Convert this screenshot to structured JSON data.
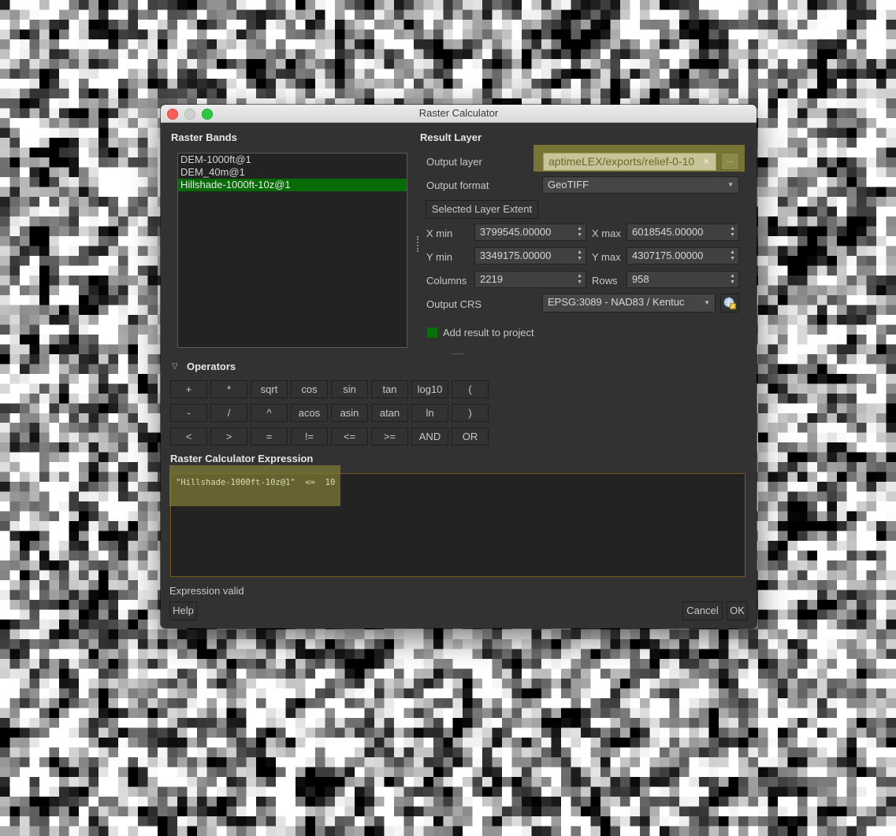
{
  "window": {
    "title": "Raster Calculator"
  },
  "raster_bands": {
    "heading": "Raster Bands",
    "items": [
      {
        "label": "DEM-1000ft@1",
        "selected": false
      },
      {
        "label": "DEM_40m@1",
        "selected": false
      },
      {
        "label": "Hillshade-1000ft-10z@1",
        "selected": true
      }
    ]
  },
  "result_layer": {
    "heading": "Result Layer",
    "output_layer_label": "Output layer",
    "output_layer_value": "aptimeLEX/exports/relief-0-10",
    "clear_icon": "×",
    "browse_label": "...",
    "output_format_label": "Output format",
    "output_format_value": "GeoTIFF",
    "selected_extent_button": "Selected Layer Extent",
    "xmin_label": "X min",
    "xmin_value": "3799545.00000",
    "xmax_label": "X max",
    "xmax_value": "6018545.00000",
    "ymin_label": "Y min",
    "ymin_value": "3349175.00000",
    "ymax_label": "Y max",
    "ymax_value": "4307175.00000",
    "columns_label": "Columns",
    "columns_value": "2219",
    "rows_label": "Rows",
    "rows_value": "958",
    "crs_label": "Output CRS",
    "crs_value": "EPSG:3089 - NAD83 / Kentuc",
    "add_result_label": "Add result to project",
    "add_result_checked": true,
    "splitter_handle": "......"
  },
  "operators": {
    "heading": "Operators",
    "rows": [
      [
        "+",
        "*",
        "sqrt",
        "cos",
        "sin",
        "tan",
        "log10",
        "("
      ],
      [
        "-",
        "/",
        "^",
        "acos",
        "asin",
        "atan",
        "ln",
        ")"
      ],
      [
        "<",
        ">",
        "=",
        "!=",
        "<=",
        ">=",
        "AND",
        "OR"
      ]
    ]
  },
  "expression": {
    "heading": "Raster Calculator Expression",
    "value": "\"Hillshade-1000ft-10z@1\"  <=  10",
    "status": "Expression valid"
  },
  "buttons": {
    "help": "Help",
    "cancel": "Cancel",
    "ok": "OK"
  },
  "colors": {
    "accent_selection": "#076b07",
    "highlight": "#7d7a35",
    "dialog_bg": "#323232"
  }
}
